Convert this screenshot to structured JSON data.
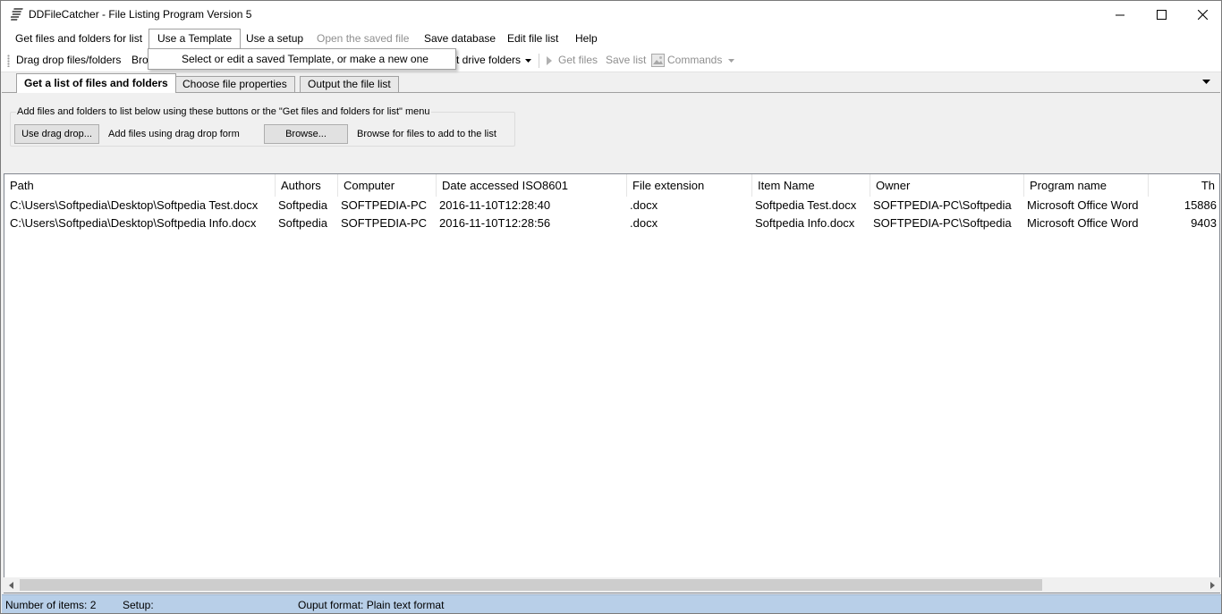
{
  "window": {
    "title": "DDFileCatcher - File Listing Program Version 5"
  },
  "menu": {
    "items": [
      {
        "label": "Get files and folders for list",
        "state": "normal"
      },
      {
        "label": "Use a Template",
        "state": "active"
      },
      {
        "label": "Use a setup",
        "state": "normal"
      },
      {
        "label": "Open the saved file",
        "state": "disabled"
      },
      {
        "label": "Save database",
        "state": "normal"
      },
      {
        "label": "Edit file list",
        "state": "normal"
      },
      {
        "label": "Help",
        "state": "normal"
      }
    ],
    "dropdown_item": "Select or edit a saved Template, or make a new one"
  },
  "toolbar": {
    "drag_drop": "Drag drop files/folders",
    "browse": "Bro",
    "drive_folders": "t drive folders",
    "get_files": "Get files",
    "save_list": "Save list",
    "commands": "Commands"
  },
  "tabs": [
    {
      "label": "Get a list of files and folders",
      "selected": true
    },
    {
      "label": "Choose file properties",
      "selected": false
    },
    {
      "label": "Output the file list",
      "selected": false
    }
  ],
  "tabpage": {
    "group_legend": "Add files and folders to list below using these buttons or the \"Get files and folders for list\" menu",
    "drag_drop_button": "Use drag drop...",
    "drag_drop_desc": "Add files using drag drop form",
    "browse_button": "Browse...",
    "browse_desc": "Browse for files to add to the list"
  },
  "list": {
    "columns": [
      "Path",
      "Authors",
      "Computer",
      "Date accessed ISO8601",
      "File extension",
      "Item Name",
      "Owner",
      "Program name",
      "Th"
    ],
    "rows": [
      [
        "C:\\Users\\Softpedia\\Desktop\\Softpedia Test.docx",
        "Softpedia",
        "SOFTPEDIA-PC",
        "2016-11-10T12:28:40",
        ".docx",
        "Softpedia Test.docx",
        "SOFTPEDIA-PC\\Softpedia",
        "Microsoft Office Word",
        "15886"
      ],
      [
        "C:\\Users\\Softpedia\\Desktop\\Softpedia Info.docx",
        "Softpedia",
        "SOFTPEDIA-PC",
        "2016-11-10T12:28:56",
        ".docx",
        "Softpedia Info.docx",
        "SOFTPEDIA-PC\\Softpedia",
        "Microsoft Office Word",
        "9403"
      ]
    ]
  },
  "status": {
    "items_count": "Number of items: 2",
    "setup": "Setup:",
    "output_format": "Ouput format: Plain text format"
  },
  "colors": {
    "statusbar": "#b8cfe8",
    "selected_tab": "#ffffff",
    "disabled_text": "#8f8f8f"
  }
}
